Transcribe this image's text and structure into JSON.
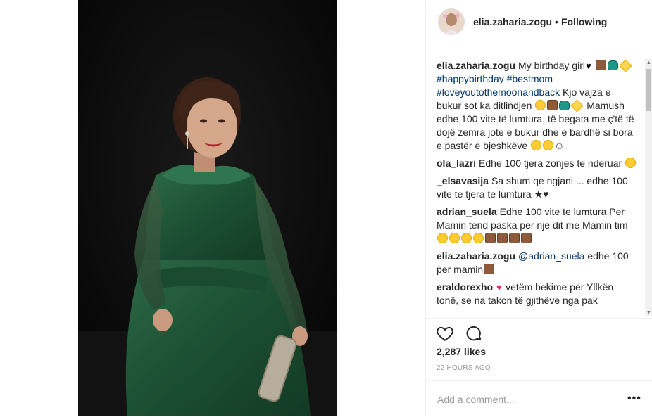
{
  "header": {
    "username": "elia.zaharia.zogu",
    "separator": "•",
    "follow_status": "Following"
  },
  "comments": [
    {
      "user": "elia.zaharia.zogu",
      "parts": [
        {
          "t": "text",
          "v": "My birthday girl"
        },
        {
          "t": "emoji",
          "v": "black-heart"
        },
        {
          "t": "emoji",
          "v": "cake"
        },
        {
          "t": "emoji",
          "v": "party-hat"
        },
        {
          "t": "emoji",
          "v": "sparkle"
        },
        {
          "t": "link",
          "v": "#happybirthday"
        },
        {
          "t": "text",
          "v": " "
        },
        {
          "t": "link",
          "v": "#bestmom"
        },
        {
          "t": "text",
          "v": " "
        },
        {
          "t": "link",
          "v": "#loveyoutothemoonandback"
        },
        {
          "t": "text",
          "v": " Kjo vajza e bukur sot ka ditlindjen "
        },
        {
          "t": "emoji",
          "v": "heart-eyes"
        },
        {
          "t": "emoji",
          "v": "cake"
        },
        {
          "t": "emoji",
          "v": "party-hat"
        },
        {
          "t": "emoji",
          "v": "sparkle"
        },
        {
          "t": "text",
          "v": " Mamush edhe 100 vite të lumtura, të begata me ç'të të dojë zemra jote e bukur dhe e bardhë si bora e pastër e bjeshkëve "
        },
        {
          "t": "emoji",
          "v": "kiss-face"
        },
        {
          "t": "emoji",
          "v": "kiss-face"
        },
        {
          "t": "text",
          "v": "☺"
        }
      ]
    },
    {
      "user": "ola_lazri",
      "parts": [
        {
          "t": "text",
          "v": "Edhe 100 tjera zonjes te nderuar "
        },
        {
          "t": "emoji",
          "v": "kiss-face"
        }
      ]
    },
    {
      "user": "_elsavasija",
      "parts": [
        {
          "t": "text",
          "v": "Sa shum qe ngjani ... edhe 100 vite te tjera te lumtura ★♥"
        }
      ]
    },
    {
      "user": "adrian_suela",
      "parts": [
        {
          "t": "text",
          "v": "Edhe 100 vite te lumtura Per Mamin tend paska per nje dit me Mamin tim "
        },
        {
          "t": "emoji",
          "v": "heart-eyes"
        },
        {
          "t": "emoji",
          "v": "heart-eyes"
        },
        {
          "t": "emoji",
          "v": "heart-eyes"
        },
        {
          "t": "emoji",
          "v": "heart-eyes"
        },
        {
          "t": "emoji",
          "v": "cake"
        },
        {
          "t": "emoji",
          "v": "cake"
        },
        {
          "t": "emoji",
          "v": "cake"
        },
        {
          "t": "emoji",
          "v": "cake"
        }
      ]
    },
    {
      "user": "elia.zaharia.zogu",
      "parts": [
        {
          "t": "link",
          "v": "@adrian_suela"
        },
        {
          "t": "text",
          "v": " edhe 100 per mamin"
        },
        {
          "t": "emoji",
          "v": "cake"
        }
      ]
    },
    {
      "user": "eraldorexho",
      "parts": [
        {
          "t": "emoji",
          "v": "red-heart"
        },
        {
          "t": "text",
          "v": "vetëm bekime për Yllkën tonë, se na takon të gjithëve nga pak"
        }
      ]
    }
  ],
  "actions": {
    "like_icon": "heart-outline-icon",
    "comment_icon": "comment-bubble-icon"
  },
  "likes_text": "2,287 likes",
  "timestamp": "22 HOURS AGO",
  "add_comment": {
    "placeholder": "Add a comment...",
    "more_label": "•••"
  },
  "colors": {
    "link": "#003569",
    "dress_green": "#1e5a3a",
    "background_photo": "#0b0b0b"
  }
}
